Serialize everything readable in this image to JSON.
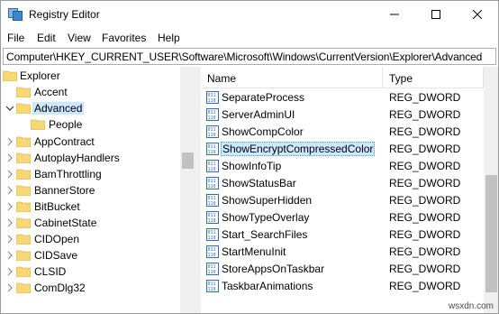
{
  "window": {
    "title": "Registry Editor"
  },
  "menu": {
    "items": [
      "File",
      "Edit",
      "View",
      "Favorites",
      "Help"
    ]
  },
  "address": {
    "path": "Computer\\HKEY_CURRENT_USER\\Software\\Microsoft\\Windows\\CurrentVersion\\Explorer\\Advanced"
  },
  "tree": {
    "items": [
      {
        "label": "Explorer",
        "state": "expanded"
      },
      {
        "label": "Accent",
        "state": "none"
      },
      {
        "label": "Advanced",
        "state": "expanded",
        "selected": true
      },
      {
        "label": "People",
        "state": "none"
      },
      {
        "label": "AppContract",
        "state": "collapsed"
      },
      {
        "label": "AutoplayHandlers",
        "state": "collapsed"
      },
      {
        "label": "BamThrottling",
        "state": "collapsed"
      },
      {
        "label": "BannerStore",
        "state": "collapsed"
      },
      {
        "label": "BitBucket",
        "state": "collapsed"
      },
      {
        "label": "CabinetState",
        "state": "collapsed"
      },
      {
        "label": "CIDOpen",
        "state": "collapsed"
      },
      {
        "label": "CIDSave",
        "state": "collapsed"
      },
      {
        "label": "CLSID",
        "state": "collapsed"
      },
      {
        "label": "ComDlg32",
        "state": "collapsed"
      }
    ]
  },
  "list": {
    "headers": {
      "name": "Name",
      "type": "Type"
    },
    "rows": [
      {
        "name": "SeparateProcess",
        "type": "REG_DWORD"
      },
      {
        "name": "ServerAdminUI",
        "type": "REG_DWORD"
      },
      {
        "name": "ShowCompColor",
        "type": "REG_DWORD"
      },
      {
        "name": "ShowEncryptCompressedColor",
        "type": "REG_DWORD",
        "selected": true
      },
      {
        "name": "ShowInfoTip",
        "type": "REG_DWORD"
      },
      {
        "name": "ShowStatusBar",
        "type": "REG_DWORD"
      },
      {
        "name": "ShowSuperHidden",
        "type": "REG_DWORD"
      },
      {
        "name": "ShowTypeOverlay",
        "type": "REG_DWORD"
      },
      {
        "name": "Start_SearchFiles",
        "type": "REG_DWORD"
      },
      {
        "name": "StartMenuInit",
        "type": "REG_DWORD"
      },
      {
        "name": "StoreAppsOnTaskbar",
        "type": "REG_DWORD"
      },
      {
        "name": "TaskbarAnimations",
        "type": "REG_DWORD"
      }
    ]
  },
  "watermark": "wsxdn.com",
  "colors": {
    "selection": "#cce8ff",
    "folder": "#f8d775",
    "icon_blue": "#2a6ebb"
  }
}
